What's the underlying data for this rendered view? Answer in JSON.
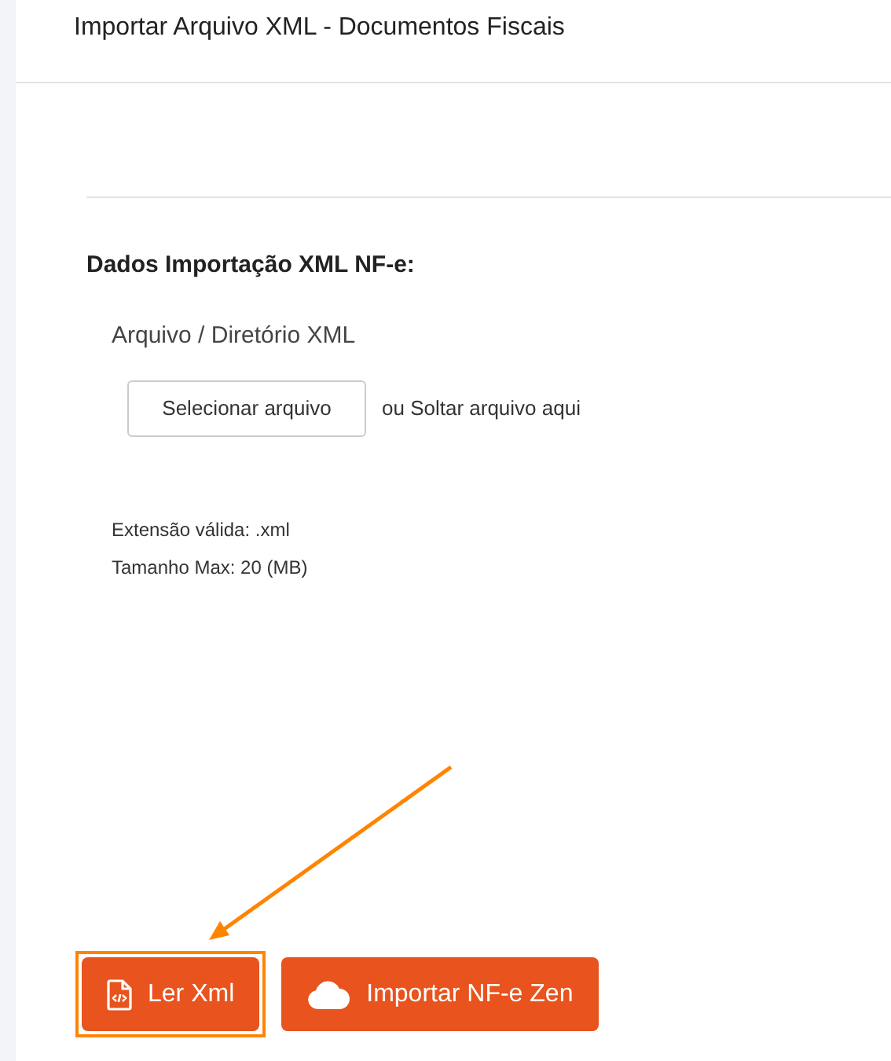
{
  "page_title": "Importar Arquivo XML - Documentos Fiscais",
  "section_title": "Dados Importação XML NF-e:",
  "file_field": {
    "label": "Arquivo / Diretório XML",
    "button": "Selecionar arquivo",
    "drop_hint": "ou Soltar arquivo aqui"
  },
  "notes": [
    "Extensão válida: .xml",
    "Tamanho Max: 20 (MB)"
  ],
  "actions": [
    {
      "kind": "file-code",
      "label": "Ler Xml",
      "highlighted": true
    },
    {
      "kind": "cloud",
      "label": "Importar NF-e Zen",
      "highlighted": false
    }
  ]
}
